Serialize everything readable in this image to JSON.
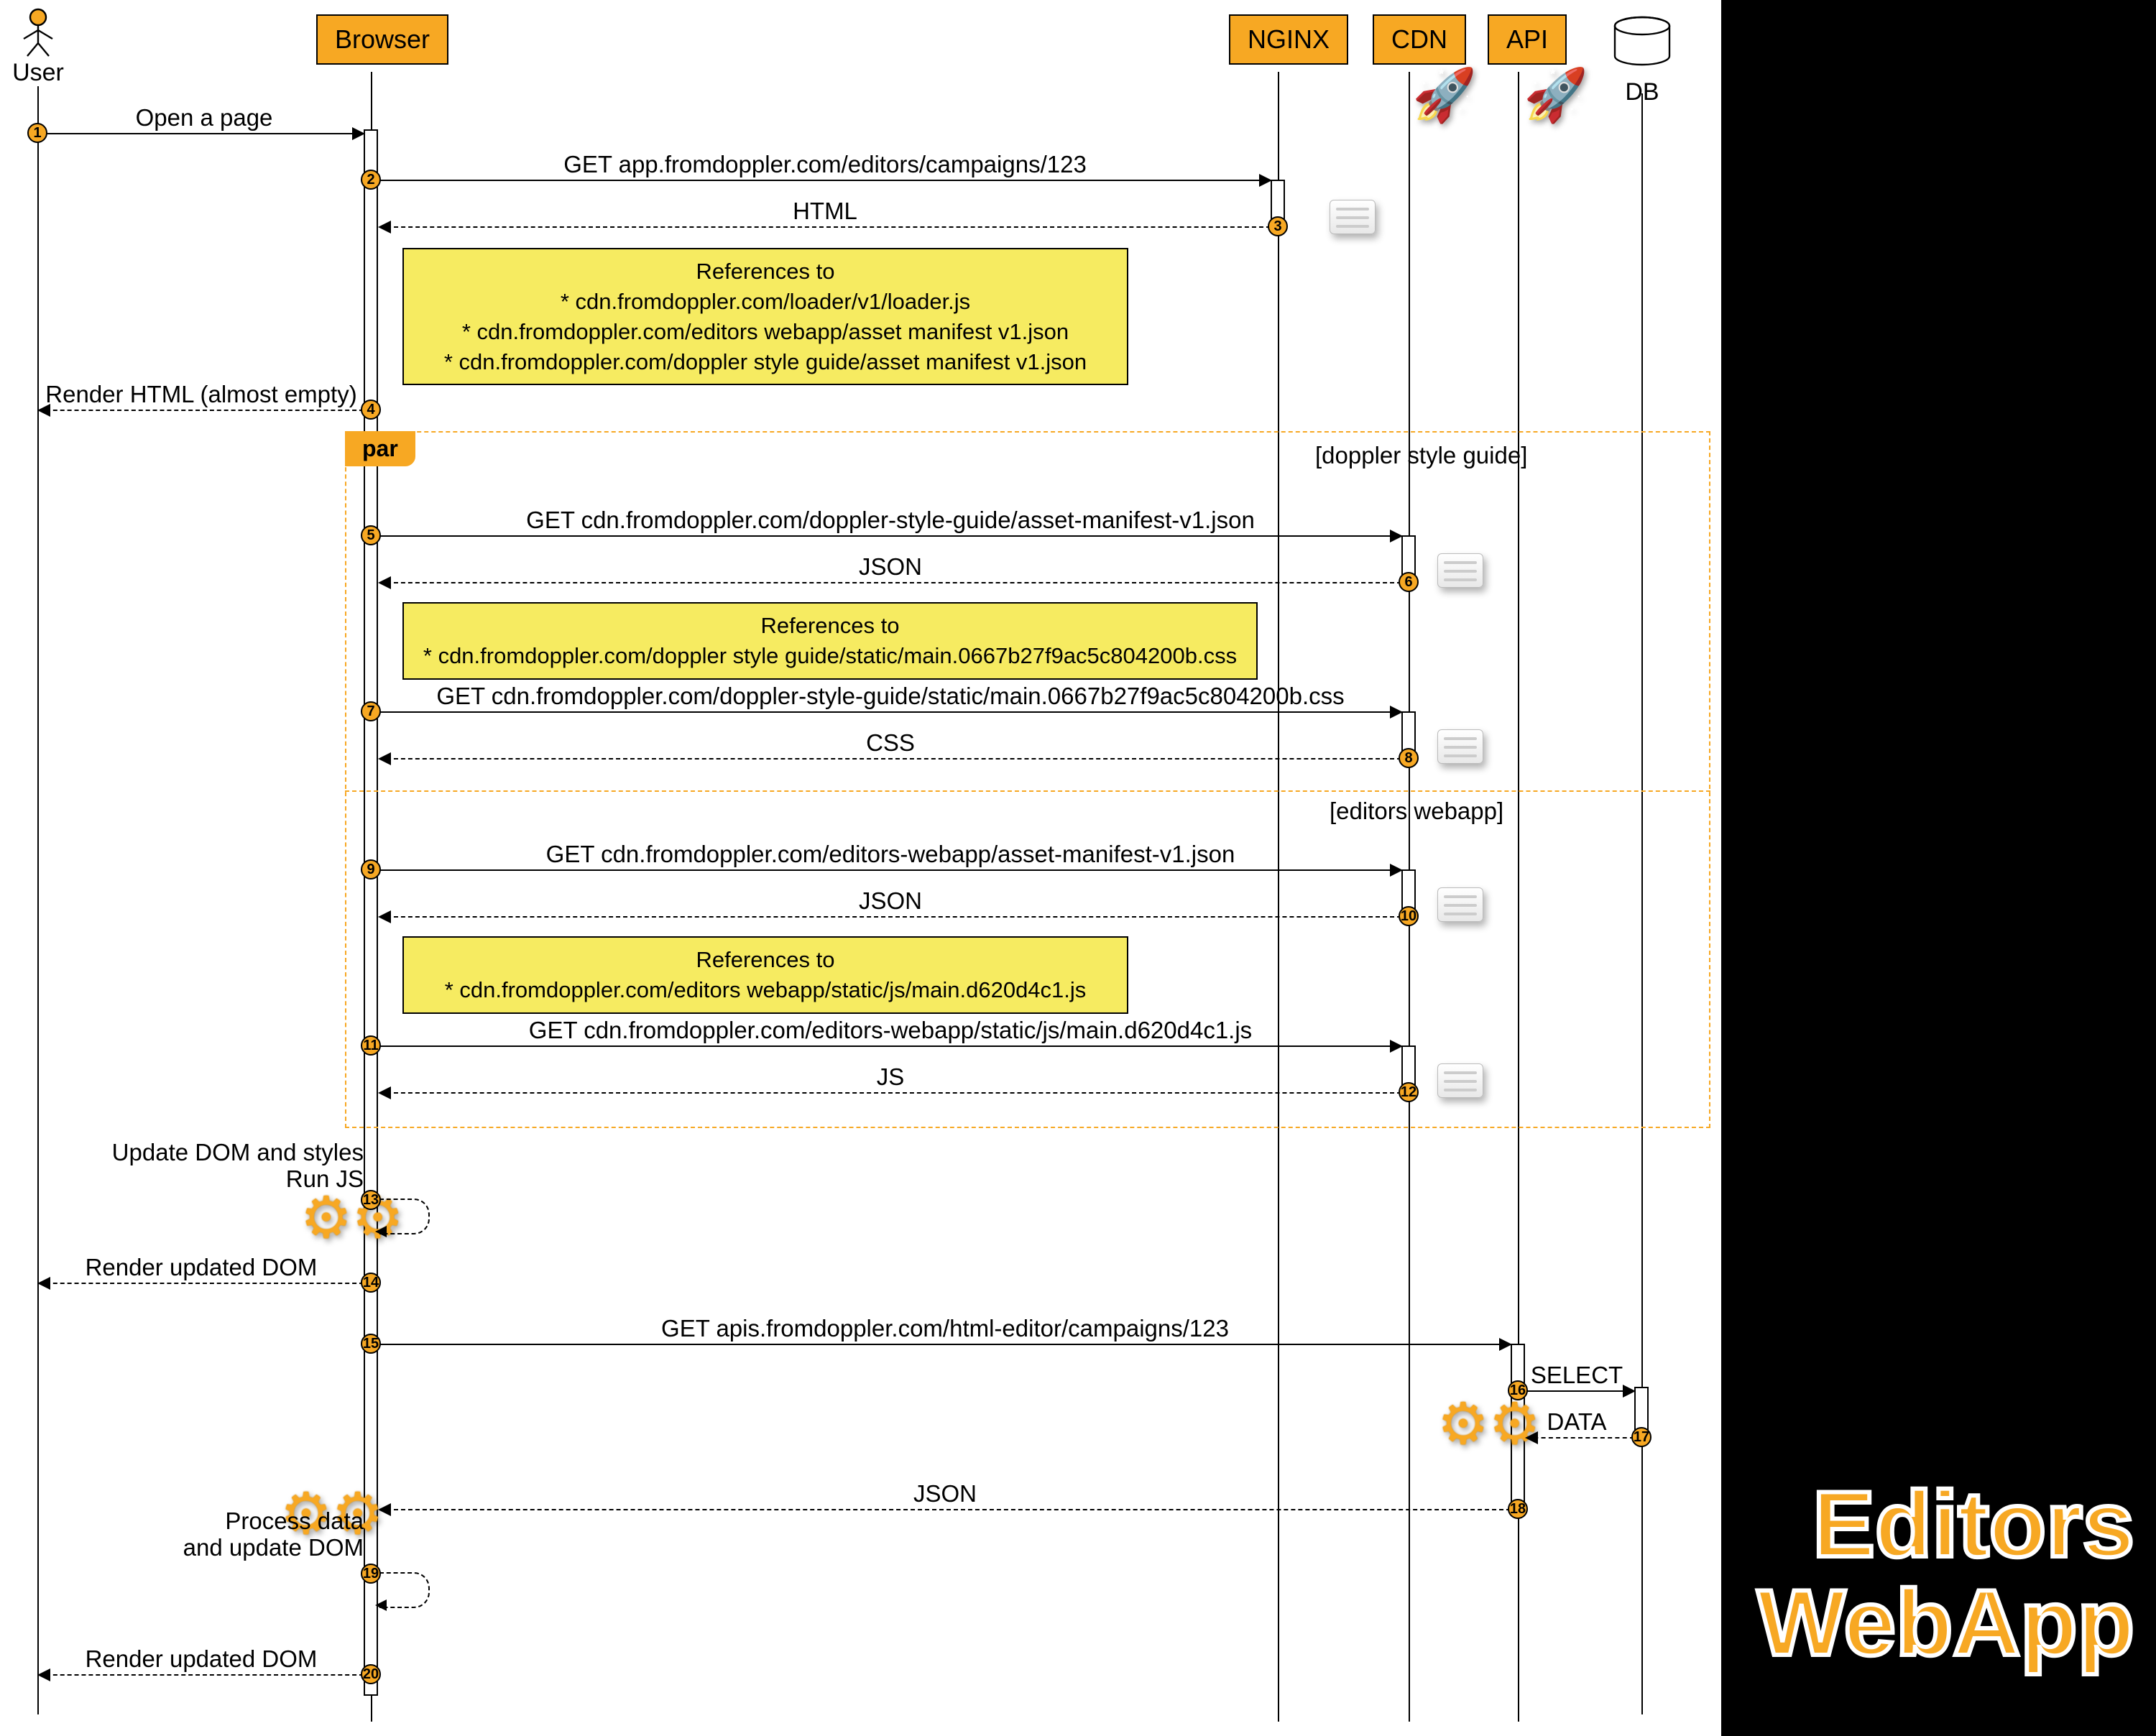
{
  "title_line1": "Editors",
  "title_line2": "WebApp",
  "participants": {
    "user": "User",
    "browser": "Browser",
    "nginx": "NGINX",
    "cdn": "CDN",
    "api": "API",
    "db": "DB"
  },
  "par": {
    "label": "par",
    "guard1": "[doppler style guide]",
    "guard2": "[editors webapp]"
  },
  "steps": {
    "1": "1",
    "2": "2",
    "3": "3",
    "4": "4",
    "5": "5",
    "6": "6",
    "7": "7",
    "8": "8",
    "9": "9",
    "10": "10",
    "11": "11",
    "12": "12",
    "13": "13",
    "14": "14",
    "15": "15",
    "16": "16",
    "17": "17",
    "18": "18",
    "19": "19",
    "20": "20"
  },
  "messages": {
    "m1": "Open a page",
    "m2": "GET app.fromdoppler.com/editors/campaigns/123",
    "m3": "HTML",
    "m4": "Render HTML (almost empty)",
    "m5": "GET cdn.fromdoppler.com/doppler-style-guide/asset-manifest-v1.json",
    "m6": "JSON",
    "m7": "GET cdn.fromdoppler.com/doppler-style-guide/static/main.0667b27f9ac5c804200b.css",
    "m8": "CSS",
    "m9": "GET cdn.fromdoppler.com/editors-webapp/asset-manifest-v1.json",
    "m10": "JSON",
    "m11": "GET cdn.fromdoppler.com/editors-webapp/static/js/main.d620d4c1.js",
    "m12": "JS",
    "m13a": "Update DOM and styles",
    "m13b": "Run JS",
    "m14": "Render updated DOM",
    "m15": "GET apis.fromdoppler.com/html-editor/campaigns/123",
    "m16": "SELECT",
    "m17": "DATA",
    "m18": "JSON",
    "m19a": "Process data",
    "m19b": "and update DOM",
    "m20": "Render updated DOM"
  },
  "notes": {
    "n3_title": "References to",
    "n3_l1": "* cdn.fromdoppler.com/loader/v1/loader.js",
    "n3_l2": "* cdn.fromdoppler.com/editors webapp/asset manifest v1.json",
    "n3_l3": "* cdn.fromdoppler.com/doppler style guide/asset manifest v1.json",
    "n6_title": "References to",
    "n6_l1": "* cdn.fromdoppler.com/doppler style guide/static/main.0667b27f9ac5c804200b.css",
    "n10_title": "References to",
    "n10_l1": "* cdn.fromdoppler.com/editors webapp/static/js/main.d620d4c1.js"
  }
}
